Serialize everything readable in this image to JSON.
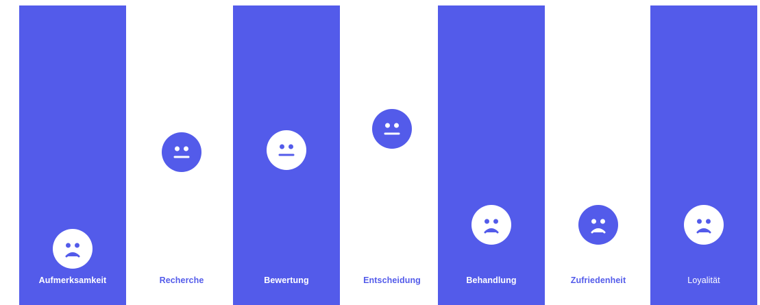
{
  "colors": {
    "accent": "#535bea",
    "background": "#ffffff"
  },
  "stages": [
    {
      "label": "Aufmerksamkeit",
      "mood": "sad",
      "face_icon": "sad-face-icon"
    },
    {
      "label": "Recherche",
      "mood": "neutral",
      "face_icon": "neutral-face-icon"
    },
    {
      "label": "Bewertung",
      "mood": "neutral",
      "face_icon": "neutral-face-icon"
    },
    {
      "label": "Entscheidung",
      "mood": "neutral",
      "face_icon": "neutral-face-icon"
    },
    {
      "label": "Behandlung",
      "mood": "sad",
      "face_icon": "sad-face-icon"
    },
    {
      "label": "Zufriedenheit",
      "mood": "sad",
      "face_icon": "sad-face-icon"
    },
    {
      "label": "Loyalität",
      "mood": "sad",
      "face_icon": "sad-face-icon"
    }
  ]
}
